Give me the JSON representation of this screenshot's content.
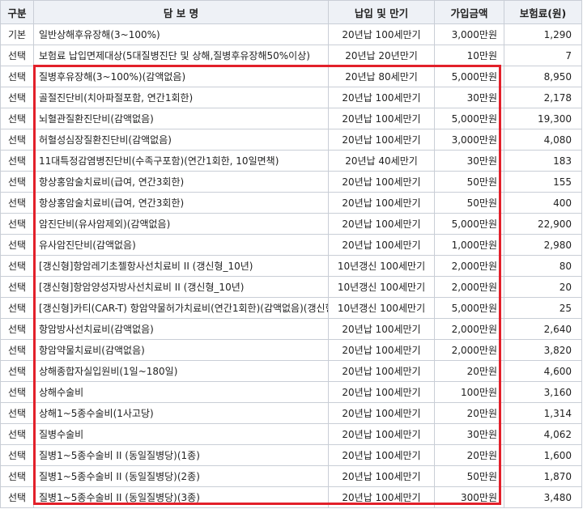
{
  "header": {
    "type": "구분",
    "name": "담 보 명",
    "term": "납입 및 만기",
    "amount": "가입금액",
    "premium": "보험료(원)"
  },
  "colors": {
    "highlight_border": "#e2202a",
    "header_bg": "#eef1f6",
    "grid": "#c9ced6"
  },
  "rows": [
    {
      "type": "기본",
      "name": "일반상해후유장해(3~100%)",
      "term": "20년납 100세만기",
      "amount": "3,000만원",
      "premium": "1,290"
    },
    {
      "type": "선택",
      "name": "보험료 납입면제대상(5대질병진단 및 상해,질병후유장해50%이상)",
      "term": "20년납 20년만기",
      "amount": "10만원",
      "premium": "7"
    },
    {
      "type": "선택",
      "name": "질병후유장해(3~100%)(감액없음)",
      "term": "20년납 80세만기",
      "amount": "5,000만원",
      "premium": "8,950"
    },
    {
      "type": "선택",
      "name": "골절진단비(치아파절포함, 연간1회한)",
      "term": "20년납 100세만기",
      "amount": "30만원",
      "premium": "2,178"
    },
    {
      "type": "선택",
      "name": "뇌혈관질환진단비(감액없음)",
      "term": "20년납 100세만기",
      "amount": "5,000만원",
      "premium": "19,300"
    },
    {
      "type": "선택",
      "name": "허혈성심장질환진단비(감액없음)",
      "term": "20년납 100세만기",
      "amount": "3,000만원",
      "premium": "4,080"
    },
    {
      "type": "선택",
      "name": "11대특정감염병진단비(수족구포함)(연간1회한, 10일면책)",
      "term": "20년납 40세만기",
      "amount": "30만원",
      "premium": "183"
    },
    {
      "type": "선택",
      "name": "항상홍암술치료비(급여, 연간3회한)",
      "term": "20년납 100세만기",
      "amount": "50만원",
      "premium": "155"
    },
    {
      "type": "선택",
      "name": "항상홍암술치료비(급여, 연간3회한)",
      "term": "20년납 100세만기",
      "amount": "50만원",
      "premium": "400"
    },
    {
      "type": "선택",
      "name": "암진단비(유사암제외)(감액없음)",
      "term": "20년납 100세만기",
      "amount": "5,000만원",
      "premium": "22,900"
    },
    {
      "type": "선택",
      "name": "유사암진단비(감액없음)",
      "term": "20년납 100세만기",
      "amount": "1,000만원",
      "premium": "2,980"
    },
    {
      "type": "선택",
      "name": "[갱신형]항암레기초젤항사선치료비 II (갱신형_10년)",
      "term": "10년갱신 100세만기",
      "amount": "2,000만원",
      "premium": "80"
    },
    {
      "type": "선택",
      "name": "[갱신형]항암양성자방사선치료비 II (갱신형_10년)",
      "term": "10년갱신 100세만기",
      "amount": "2,000만원",
      "premium": "20"
    },
    {
      "type": "선택",
      "name": "[갱신형]카티(CAR-T) 항암약물허가치료비(연간1회한)(감액없음)(갱신형_10년)",
      "term": "10년갱신 100세만기",
      "amount": "5,000만원",
      "premium": "25"
    },
    {
      "type": "선택",
      "name": "항암방사선치료비(감액없음)",
      "term": "20년납 100세만기",
      "amount": "2,000만원",
      "premium": "2,640"
    },
    {
      "type": "선택",
      "name": "항암약물치료비(감액없음)",
      "term": "20년납 100세만기",
      "amount": "2,000만원",
      "premium": "3,820"
    },
    {
      "type": "선택",
      "name": "상해종합자실입원비(1일~180일)",
      "term": "20년납 100세만기",
      "amount": "20만원",
      "premium": "4,600"
    },
    {
      "type": "선택",
      "name": "상해수술비",
      "term": "20년납 100세만기",
      "amount": "100만원",
      "premium": "3,160"
    },
    {
      "type": "선택",
      "name": "상해1~5종수술비(1사고당)",
      "term": "20년납 100세만기",
      "amount": "20만원",
      "premium": "1,314"
    },
    {
      "type": "선택",
      "name": "질병수술비",
      "term": "20년납 100세만기",
      "amount": "30만원",
      "premium": "4,062"
    },
    {
      "type": "선택",
      "name": "질병1~5종수술비 II (동일질병당)(1종)",
      "term": "20년납 100세만기",
      "amount": "20만원",
      "premium": "1,600"
    },
    {
      "type": "선택",
      "name": "질병1~5종수술비 II (동일질병당)(2종)",
      "term": "20년납 100세만기",
      "amount": "50만원",
      "premium": "1,870"
    },
    {
      "type": "선택",
      "name": "질병1~5종수술비 II (동일질병당)(3종)",
      "term": "20년납 100세만기",
      "amount": "300만원",
      "premium": "3,480"
    }
  ]
}
